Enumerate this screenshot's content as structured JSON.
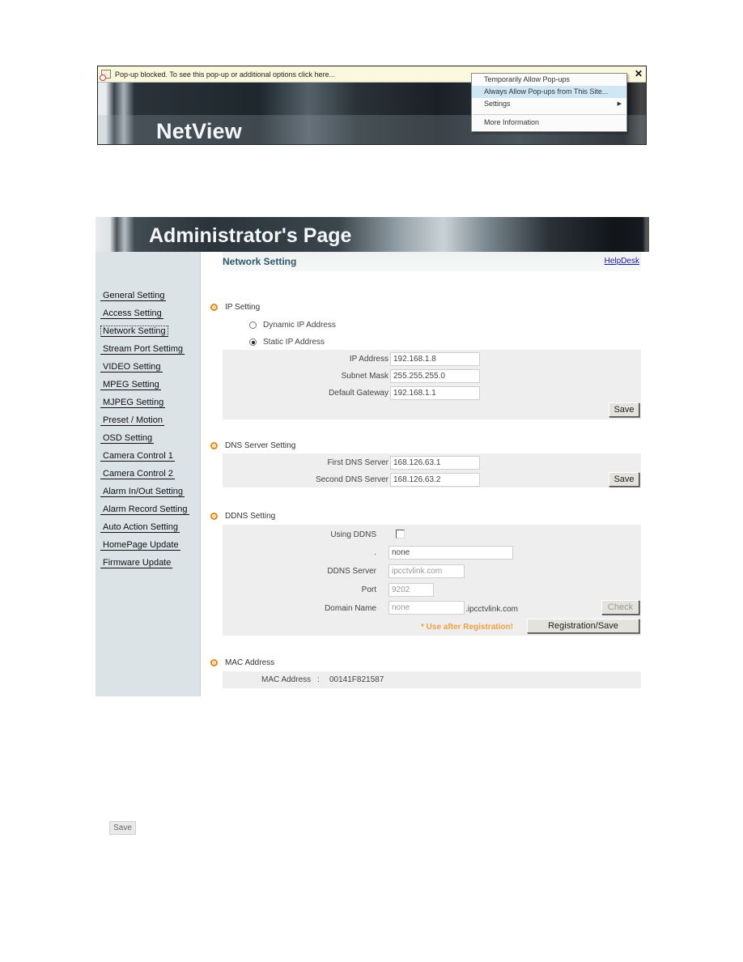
{
  "popup_screenshot": {
    "infobar_text": "Pop-up blocked. To see this pop-up or additional options click here...",
    "close_label": "✕",
    "banner_title": "NetView",
    "menu_items": [
      {
        "label": "Temporarily Allow Pop-ups"
      },
      {
        "label": "Always Allow Pop-ups from This Site..."
      },
      {
        "label": "Settings",
        "submenu_arrow": "▶"
      },
      {
        "label": "More Information"
      }
    ]
  },
  "admin": {
    "banner_title": "Administrator's Page",
    "page_title": "Network Setting",
    "helpdesk_label": "HelpDesk",
    "sidebar": {
      "items": [
        {
          "label": "General Setting"
        },
        {
          "label": "Access Setting"
        },
        {
          "label": "Network Setting",
          "active": true
        },
        {
          "label": "Stream Port Settimg"
        },
        {
          "label": "VIDEO Setting"
        },
        {
          "label": "MPEG Setting"
        },
        {
          "label": "MJPEG Setting"
        },
        {
          "label": "Preset / Motion"
        },
        {
          "label": "OSD Setting"
        },
        {
          "label": "Camera Control 1"
        },
        {
          "label": "Camera Control 2"
        },
        {
          "label": "Alarm In/Out Setting"
        },
        {
          "label": "Alarm Record Setting"
        },
        {
          "label": "Auto Action Setting"
        },
        {
          "label": "HomePage Update"
        },
        {
          "label": "Firmware Update"
        }
      ]
    },
    "ip_setting": {
      "title": "IP Setting",
      "dynamic_label": "Dynamic IP Address",
      "static_label": "Static IP Address",
      "selected": "static",
      "ip_address_label": "IP Address",
      "ip_address": "192.168.1.8",
      "subnet_mask_label": "Subnet Mask",
      "subnet_mask": "255.255.255.0",
      "gateway_label": "Default Gateway",
      "gateway": "192.168.1.1",
      "save_label": "Save"
    },
    "dns_setting": {
      "title": "DNS Server Setting",
      "first_label": "First DNS Server",
      "first": "168.126.63.1",
      "second_label": "Second DNS Server",
      "second": "168.126.63.2",
      "save_label": "Save"
    },
    "ddns_setting": {
      "title": "DDNS Setting",
      "using_label": "Using DDNS",
      "using_checked": false,
      "dot_label": ".",
      "dot_value": "none",
      "server_label": "DDNS Server",
      "server_value": "ipcctvlink.com",
      "port_label": "Port",
      "port_value": "9202",
      "domain_label": "Domain Name",
      "domain_value": "none",
      "domain_suffix": ".ipcctvlink.com",
      "check_label": "Check",
      "note": "* Use after Registration!",
      "register_label": "Registration/Save"
    },
    "mac_setting": {
      "title": "MAC Address",
      "label": "MAC Address",
      "separator": ":",
      "value": "00141F821587"
    }
  },
  "standalone_save_label": "Save"
}
